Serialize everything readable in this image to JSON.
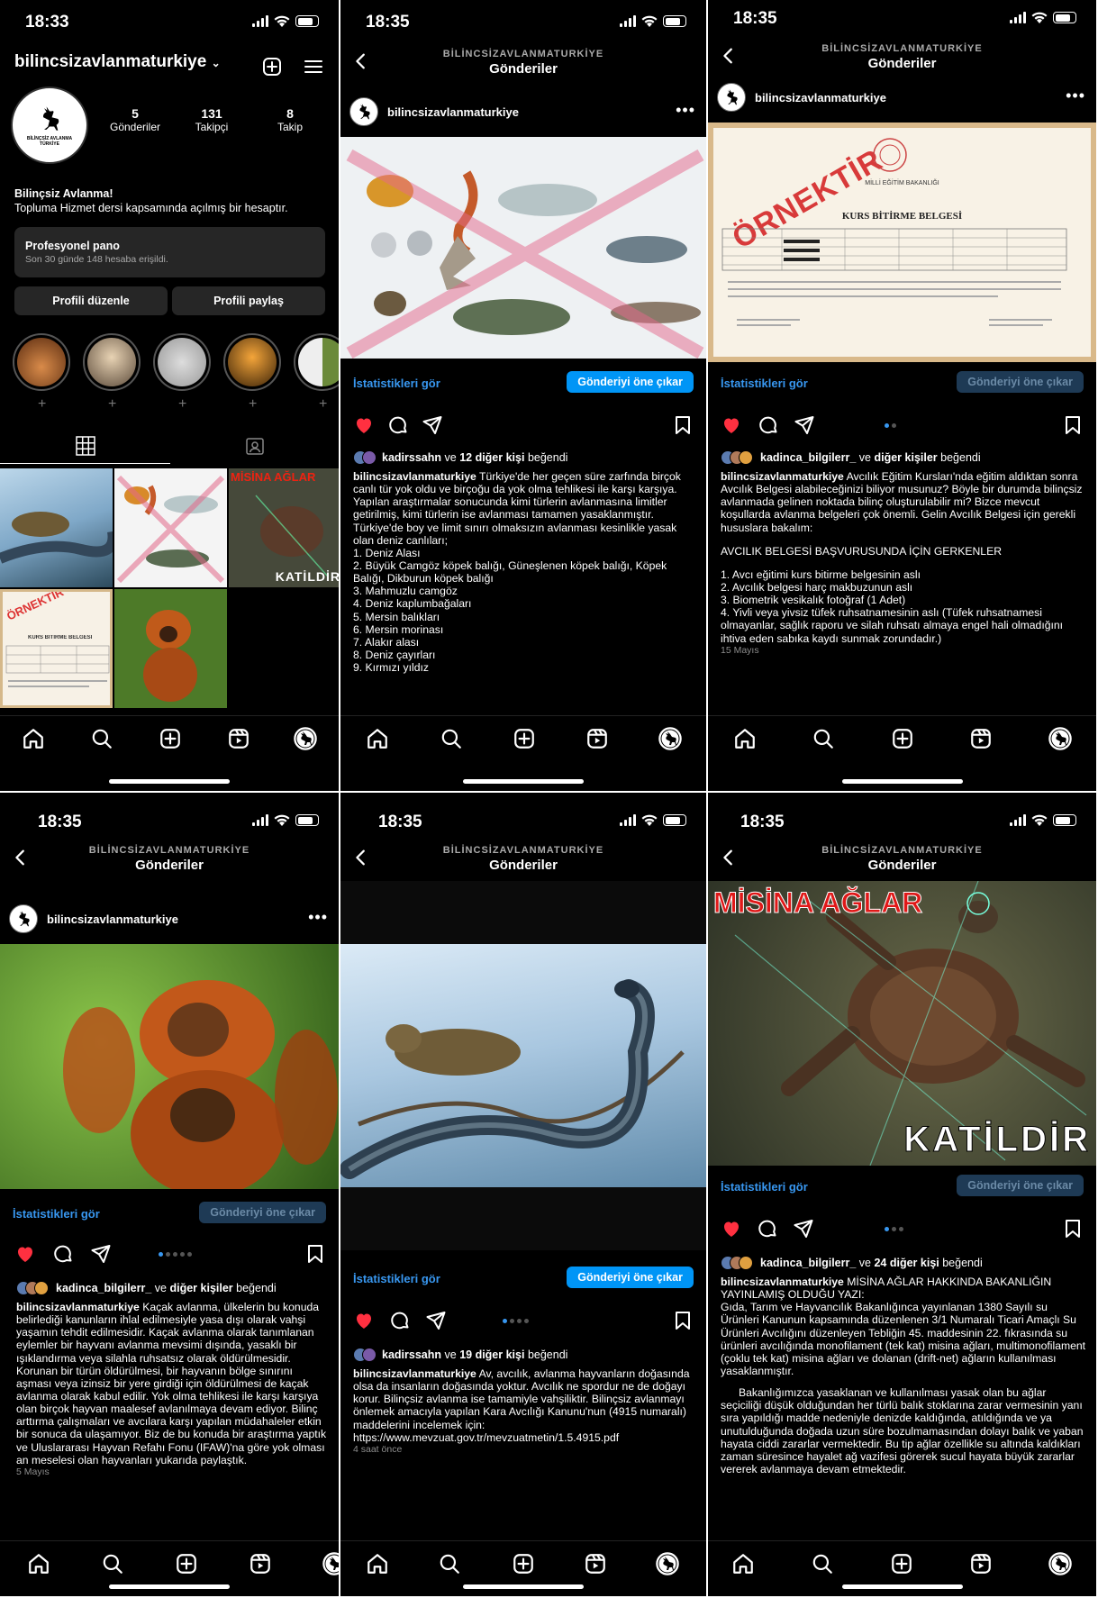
{
  "status": {
    "time1": "18:33",
    "time": "18:35"
  },
  "header": {
    "account": "BİLİNCSİZAVLANMATURKİYE",
    "title": "Gönderiler"
  },
  "profile": {
    "username": "bilincsizavlanmaturkiye",
    "avatar_text": "BİLİNÇSİZ AVLANMA TÜRKİYE",
    "posts_count": "5",
    "posts_label": "Gönderiler",
    "followers_count": "131",
    "followers_label": "Takipçi",
    "following_count": "8",
    "following_label": "Takip",
    "bio_title": "Bilinçsiz Avlanma!",
    "bio_text": "Topluma Hizmet dersi kapsamında açılmış bir hesaptır.",
    "pro_panel_title": "Profesyonel pano",
    "pro_panel_sub": "Son 30 günde 148 hesaba erişildi.",
    "edit_button": "Profili düzenle",
    "share_button": "Profili paylaş"
  },
  "common": {
    "username": "bilincsizavlanmaturkiye",
    "stats_link": "İstatistikleri gör",
    "boost_button": "Gönderiyi öne çıkar",
    "misina_title": "MİSİNA AĞLAR",
    "katildir": "KATİLDİR",
    "ornektir": "ÖRNEKTİR",
    "cert_title": "KURS BİTİRME BELGESİ",
    "cert_ministry": "MİLLİ EĞİTİM BAKANLIĞI"
  },
  "post1": {
    "likes_user": "kadirssahn",
    "likes_rest": "12 diğer kişi",
    "likes_prefix": "ve",
    "likes_suffix": "beğendi",
    "caption_lines": [
      "Türkiye'de her geçen süre zarfında birçok canlı tür yok oldu ve birçoğu da yok olma tehlikesi ile karşı karşıya. Yapılan araştırmalar sonucunda kimi türlerin avlanmasına limitler getirilmiş, kimi türlerin ise avlanması tamamen yasaklanmıştır.",
      "Türkiye'de boy ve limit sınırı olmaksızın avlanması kesinlikle yasak olan deniz canlıları;",
      "1. Deniz Alası",
      "2. Büyük Camgöz köpek balığı, Güneşlenen köpek balığı, Köpek Balığı, Dikburun köpek balığı",
      "3. Mahmuzlu camgöz",
      "4. Deniz kaplumbağaları",
      "5. Mersin balıkları",
      "6. Mersin morinası",
      "7. Alakır alası",
      "8. Deniz çayırları",
      "9. Kırmızı yıldız"
    ]
  },
  "post2": {
    "likes_user": "kadinca_bilgilerr_",
    "likes_rest": "diğer kişiler",
    "likes_prefix": "ve",
    "likes_suffix": "beğendi",
    "caption_lines": [
      "Avcılık Eğitim Kursları'nda eğitim aldıktan sonra Avcılık Belgesi alabileceğinizi biliyor musunuz? Böyle bir durumda bilinçsiz avlanmada gelinen noktada bilinç oluşturulabilir mi? Bizce mevcut koşullarda avlanma belgeleri çok önemli. Gelin Avcılık Belgesi için gerekli hususlara bakalım:",
      "AVCILIK BELGESİ BAŞVURUSUNDA İÇİN GERKENLER",
      "1. Avcı eğitimi kurs bitirme belgesinin aslı",
      "2. Avcılık belgesi harç makbuzunun aslı",
      "3. Biometrik vesikalık fotoğraf (1 Adet)",
      "4. Yivli veya yivsiz tüfek ruhsatnamesinin aslı (Tüfek ruhsatnamesi olmayanlar, sağlık raporu ve silah ruhsatı almaya engel hali olmadığını ihtiva eden sabıka kaydı sunmak zorundadır.)"
    ],
    "date": "15 Mayıs"
  },
  "post3": {
    "likes_user": "kadinca_bilgilerr_",
    "likes_rest": "diğer kişiler",
    "likes_prefix": "ve",
    "likes_suffix": "beğendi",
    "caption": "Kaçak avlanma, ülkelerin bu konuda belirlediği kanunların ihlal edilmesiyle yasa dışı olarak vahşi yaşamın tehdit edilmesidir. Kaçak avlanma olarak tanımlanan eylemler bir hayvanı avlanma mevsimi dışında, yasaklı bir ışıklandırma veya silahla ruhsatsız olarak öldürülmesidir. Korunan bir türün öldürülmesi, bir hayvanın bölge sınırını aşması veya izinsiz bir yere girdiği için öldürülmesi de kaçak avlanma olarak kabul edilir. Yok olma tehlikesi ile karşı karşıya olan birçok hayvan maalesef avlanılmaya devam ediyor. Bilinç arttırma çalışmaları ve avcılara karşı yapılan müdahaleler etkin bir sonuca da ulaşamıyor. Biz de bu konuda bir araştırma yaptık ve Uluslararası Hayvan Refahı Fonu (IFAW)'na göre yok olması an meselesi olan hayvanları yukarıda paylaştık.",
    "date": "5 Mayıs"
  },
  "post4": {
    "likes_user": "kadirssahn",
    "likes_rest": "19 diğer kişi",
    "likes_prefix": "ve",
    "likes_suffix": "beğendi",
    "caption": "Av, avcılık, avlanma hayvanların doğasında olsa da insanların doğasında yoktur. Avcılık ne spordur ne de doğayı korur. Bilinçsiz avlanma ise tamamiyle vahşiliktir. Bilinçsiz avlanmayı önlemek amacıyla yapılan Kara Avcılığı Kanunu'nun (4915 numaralı) maddelerini incelemek için: https://www.mevzuat.gov.tr/mevzuatmetin/1.5.4915.pdf",
    "date": "4 saat önce"
  },
  "post5": {
    "likes_user": "kadinca_bilgilerr_",
    "likes_rest": "24 diğer kişi",
    "likes_prefix": "ve",
    "likes_suffix": "beğendi",
    "caption_head": "MİSİNA AĞLAR HAKKINDA BAKANLIĞIN YAYINLAMIŞ OLDUĞU YAZI:",
    "caption_p1": "Gıda, Tarım ve Hayvancılık Bakanlığınca yayınlanan 1380 Sayılı su Ürünleri Kanunun kapsamında düzenlenen 3/1 Numaralı Ticari Amaçlı Su Ürünleri Avcılığını düzenleyen Tebliğin 45. maddesinin 22. fıkrasında su ürünleri avcılığında monofilament (tek kat) misina ağları, multimonofilament (çoklu tek kat) misina ağları ve dolanan (drift-net) ağların kullanılması yasaklanmıştır.",
    "caption_p2": "Bakanlığımızca yasaklanan ve kullanılması yasak olan bu ağlar seçiciliği düşük olduğundan her türlü balık stoklarına zarar vermesinin yanı sıra yapıldığı madde nedeniyle denizde kaldığında, atıldığında ve ya unutulduğunda doğada uzun süre bozulmamasından dolayı balık ve yaban hayata ciddi zararlar vermektedir. Bu tip ağlar özellikle su altında kaldıkları zaman süresince hayalet ağ vazifesi görerek sucul hayata büyük zararlar vererek avlanmaya devam etmektedir."
  },
  "colors": {
    "accent": "#0095f6",
    "link": "#3897f0",
    "like": "#ff3040"
  }
}
